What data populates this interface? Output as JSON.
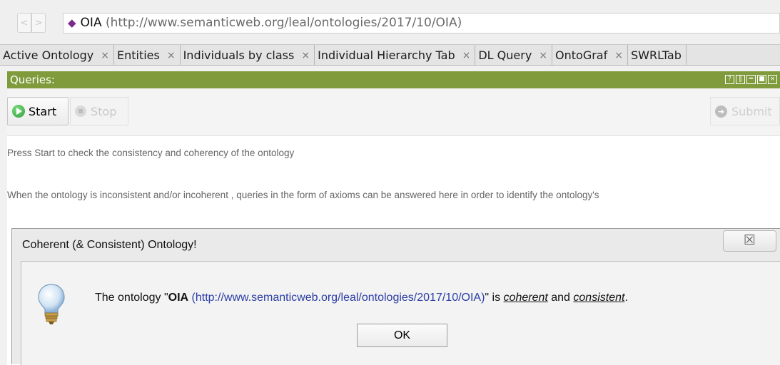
{
  "address_bar": {
    "back_icon": "<",
    "forward_icon": ">",
    "ontology_name": "OIA",
    "ontology_iri": "(http://www.semanticweb.org/leal/ontologies/2017/10/OIA)"
  },
  "tabs": [
    {
      "label": "Active Ontology"
    },
    {
      "label": "Entities"
    },
    {
      "label": "Individuals by class"
    },
    {
      "label": "Individual Hierarchy Tab"
    },
    {
      "label": "DL Query"
    },
    {
      "label": "OntoGraf"
    },
    {
      "label": "SWRLTab"
    }
  ],
  "tab_close_glyph": "×",
  "panel": {
    "title": "Queries:",
    "start_label": "Start",
    "stop_label": "Stop",
    "submit_label": "Submit",
    "message_1": "Press Start to check the consistency and coherency of the ontology",
    "message_2": "When the ontology is inconsistent and/or incoherent , queries in the form of axioms can be answered here in order to identify the ontology's"
  },
  "dialog": {
    "title": "Coherent (& Consistent) Ontology!",
    "close_glyph": "☒",
    "msg_prefix": "The ontology \"",
    "msg_name": "OIA",
    "msg_iri": " (http://www.semanticweb.org/leal/ontologies/2017/10/OIA)",
    "msg_mid": "\" is ",
    "msg_coherent": "coherent",
    "msg_and": " and ",
    "msg_consistent": "consistent",
    "msg_end": ".",
    "ok_label": "OK"
  },
  "icons": {
    "ontology": "diamond-icon",
    "start": "play-icon",
    "stop": "stop-icon",
    "submit": "arrow-icon",
    "dialog": "lightbulb-icon"
  }
}
